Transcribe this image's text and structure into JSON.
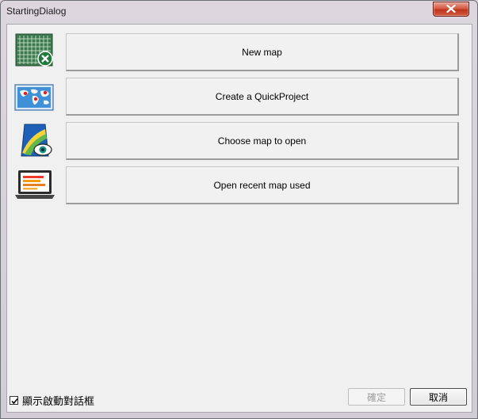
{
  "window": {
    "title": "StartingDialog",
    "close_icon": "close-icon"
  },
  "actions": [
    {
      "label": "New map",
      "icon": "new-map-grid-icon"
    },
    {
      "label": "Create a QuickProject",
      "icon": "world-map-icon"
    },
    {
      "label": "Choose map to open",
      "icon": "map-view-eye-icon"
    },
    {
      "label": "Open recent map used",
      "icon": "laptop-recent-icon"
    }
  ],
  "footer": {
    "show_dialog_label": "顯示啟動對話框",
    "show_dialog_checked": true,
    "ok_label": "確定",
    "ok_enabled": false,
    "cancel_label": "取消"
  }
}
